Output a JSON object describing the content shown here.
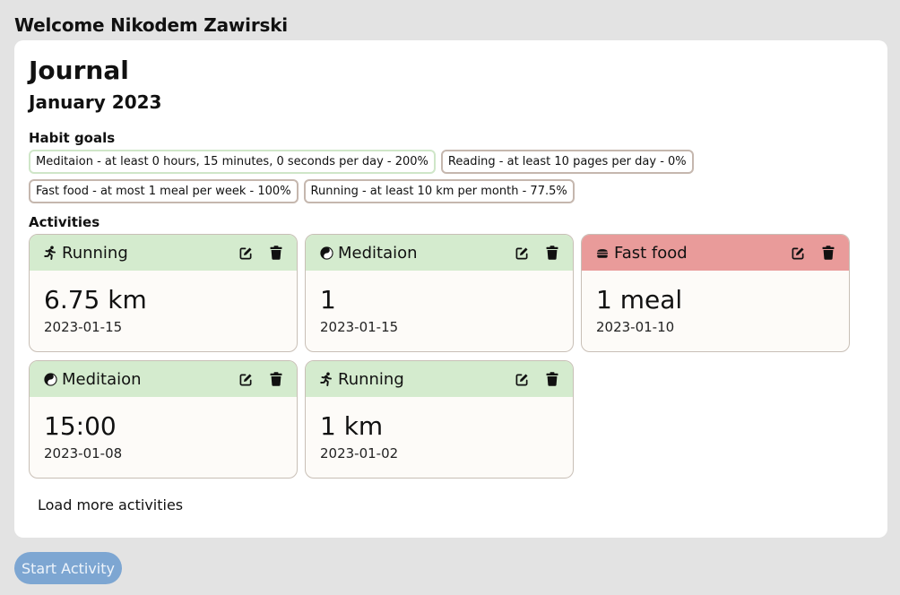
{
  "header": {
    "welcome": "Welcome Nikodem Zawirski"
  },
  "journal": {
    "title": "Journal",
    "month": "January 2023",
    "habit_goals_label": "Habit goals",
    "goals": [
      {
        "text": "Meditaion - at least 0 hours, 15 minutes, 0 seconds per day - 200%",
        "status": "met"
      },
      {
        "text": "Reading - at least 10 pages per day - 0%",
        "status": "unmet"
      },
      {
        "text": "Fast food - at most 1 meal per week - 100%",
        "status": "unmet"
      },
      {
        "text": "Running - at least 10 km per month - 77.5%",
        "status": "unmet"
      }
    ],
    "activities_label": "Activities",
    "activities": [
      {
        "type": "Running",
        "icon": "running-icon",
        "value": "6.75 km",
        "date": "2023-01-15",
        "status": "good"
      },
      {
        "type": "Meditaion",
        "icon": "yin-yang-icon",
        "value": "1",
        "date": "2023-01-15",
        "status": "good"
      },
      {
        "type": "Fast food",
        "icon": "burger-icon",
        "value": "1 meal",
        "date": "2023-01-10",
        "status": "bad"
      },
      {
        "type": "Meditaion",
        "icon": "yin-yang-icon",
        "value": "15:00",
        "date": "2023-01-08",
        "status": "good"
      },
      {
        "type": "Running",
        "icon": "running-icon",
        "value": "1 km",
        "date": "2023-01-02",
        "status": "good"
      }
    ],
    "load_more_label": "Load more activities"
  },
  "footer": {
    "start_activity_label": "Start Activity"
  },
  "colors": {
    "good_header": "#d4ebce",
    "bad_header": "#e99b9a",
    "goal_met_border": "#cfe6c8",
    "goal_border": "#c5b7ae",
    "start_button": "#7da6d2"
  }
}
